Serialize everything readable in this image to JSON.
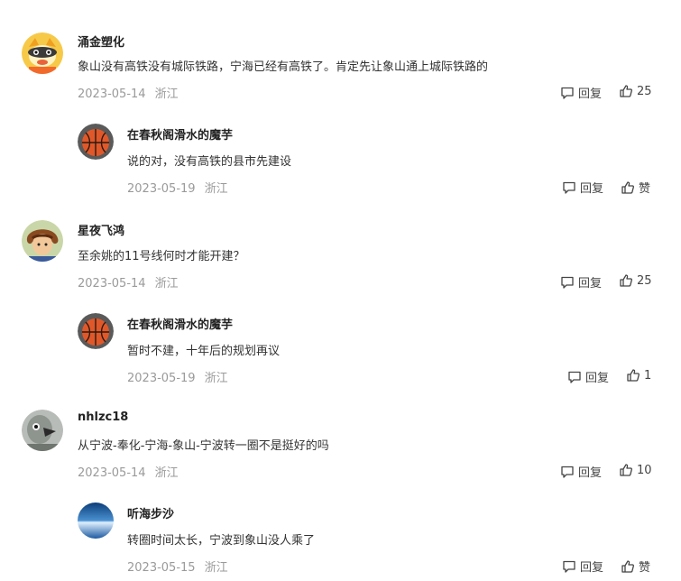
{
  "comments": [
    {
      "username": "涌金塑化",
      "content": "象山没有高铁没有城际铁路，宁海已经有高铁了。肯定先让象山通上城际铁路的",
      "date": "2023-05-14",
      "location": "浙江",
      "reply_label": "回复",
      "likes": "25",
      "reply": {
        "username": "在春秋阁滑水的魔芋",
        "content": "说的对，没有高铁的县市先建设",
        "date": "2023-05-19",
        "location": "浙江",
        "reply_label": "回复",
        "likes": "赞"
      }
    },
    {
      "username": "星夜飞鸿",
      "content": "至余姚的11号线何时才能开建？",
      "date": "2023-05-14",
      "location": "浙江",
      "reply_label": "回复",
      "likes": "25",
      "reply": {
        "username": "在春秋阁滑水的魔芋",
        "content": "暂时不建，十年后的规划再议",
        "date": "2023-05-19",
        "location": "浙江",
        "reply_label": "回复",
        "likes": "1"
      }
    },
    {
      "username": "nhlzc18",
      "content": "从宁波-奉化-宁海-象山-宁波转一圈不是挺好的吗",
      "date": "2023-05-14",
      "location": "浙江",
      "reply_label": "回复",
      "likes": "10",
      "reply": {
        "username": "听海步沙",
        "content": "转圈时间太长，宁波到象山没人乘了",
        "date": "2023-05-15",
        "location": "浙江",
        "reply_label": "回复",
        "likes": "赞"
      }
    }
  ],
  "icons": {
    "reply": "comment-bubble-icon",
    "like": "thumbs-up-icon"
  }
}
